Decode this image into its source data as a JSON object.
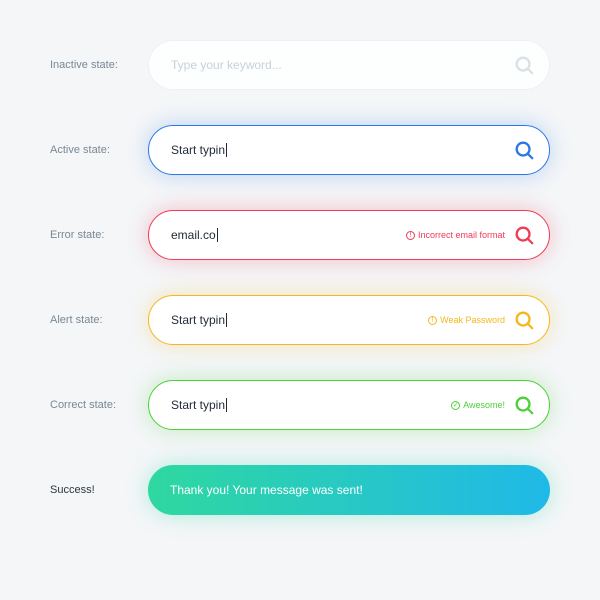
{
  "labels": {
    "inactive": "Inactive state:",
    "active": "Active state:",
    "error": "Error state:",
    "alert": "Alert state:",
    "correct": "Correct state:",
    "success": "Success!"
  },
  "fields": {
    "inactive": {
      "placeholder": "Type your keyword..."
    },
    "active": {
      "value": "Start typin"
    },
    "error": {
      "value": "email.co",
      "message": "Incorrect email format"
    },
    "alert": {
      "value": "Start typin",
      "message": "Weak Password"
    },
    "correct": {
      "value": "Start typin",
      "message": "Awesome!"
    },
    "success": {
      "text": "Thank you! Your message was sent!"
    }
  },
  "colors": {
    "active": "#2b78e4",
    "error": "#ef3b57",
    "alert": "#f5b81c",
    "correct": "#4cd13a",
    "inactive_icon": "#d9e0e6"
  }
}
